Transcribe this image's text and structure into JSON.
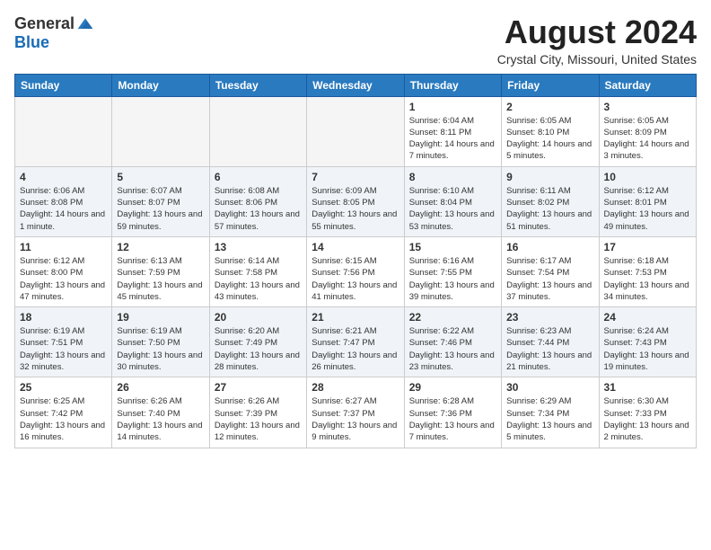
{
  "logo": {
    "general": "General",
    "blue": "Blue"
  },
  "title": "August 2024",
  "location": "Crystal City, Missouri, United States",
  "weekdays": [
    "Sunday",
    "Monday",
    "Tuesday",
    "Wednesday",
    "Thursday",
    "Friday",
    "Saturday"
  ],
  "weeks": [
    [
      {
        "day": "",
        "empty": true
      },
      {
        "day": "",
        "empty": true
      },
      {
        "day": "",
        "empty": true
      },
      {
        "day": "",
        "empty": true
      },
      {
        "day": "1",
        "sunrise": "6:04 AM",
        "sunset": "8:11 PM",
        "daylight": "14 hours and 7 minutes."
      },
      {
        "day": "2",
        "sunrise": "6:05 AM",
        "sunset": "8:10 PM",
        "daylight": "14 hours and 5 minutes."
      },
      {
        "day": "3",
        "sunrise": "6:05 AM",
        "sunset": "8:09 PM",
        "daylight": "14 hours and 3 minutes."
      }
    ],
    [
      {
        "day": "4",
        "sunrise": "6:06 AM",
        "sunset": "8:08 PM",
        "daylight": "14 hours and 1 minute."
      },
      {
        "day": "5",
        "sunrise": "6:07 AM",
        "sunset": "8:07 PM",
        "daylight": "13 hours and 59 minutes."
      },
      {
        "day": "6",
        "sunrise": "6:08 AM",
        "sunset": "8:06 PM",
        "daylight": "13 hours and 57 minutes."
      },
      {
        "day": "7",
        "sunrise": "6:09 AM",
        "sunset": "8:05 PM",
        "daylight": "13 hours and 55 minutes."
      },
      {
        "day": "8",
        "sunrise": "6:10 AM",
        "sunset": "8:04 PM",
        "daylight": "13 hours and 53 minutes."
      },
      {
        "day": "9",
        "sunrise": "6:11 AM",
        "sunset": "8:02 PM",
        "daylight": "13 hours and 51 minutes."
      },
      {
        "day": "10",
        "sunrise": "6:12 AM",
        "sunset": "8:01 PM",
        "daylight": "13 hours and 49 minutes."
      }
    ],
    [
      {
        "day": "11",
        "sunrise": "6:12 AM",
        "sunset": "8:00 PM",
        "daylight": "13 hours and 47 minutes."
      },
      {
        "day": "12",
        "sunrise": "6:13 AM",
        "sunset": "7:59 PM",
        "daylight": "13 hours and 45 minutes."
      },
      {
        "day": "13",
        "sunrise": "6:14 AM",
        "sunset": "7:58 PM",
        "daylight": "13 hours and 43 minutes."
      },
      {
        "day": "14",
        "sunrise": "6:15 AM",
        "sunset": "7:56 PM",
        "daylight": "13 hours and 41 minutes."
      },
      {
        "day": "15",
        "sunrise": "6:16 AM",
        "sunset": "7:55 PM",
        "daylight": "13 hours and 39 minutes."
      },
      {
        "day": "16",
        "sunrise": "6:17 AM",
        "sunset": "7:54 PM",
        "daylight": "13 hours and 37 minutes."
      },
      {
        "day": "17",
        "sunrise": "6:18 AM",
        "sunset": "7:53 PM",
        "daylight": "13 hours and 34 minutes."
      }
    ],
    [
      {
        "day": "18",
        "sunrise": "6:19 AM",
        "sunset": "7:51 PM",
        "daylight": "13 hours and 32 minutes."
      },
      {
        "day": "19",
        "sunrise": "6:19 AM",
        "sunset": "7:50 PM",
        "daylight": "13 hours and 30 minutes."
      },
      {
        "day": "20",
        "sunrise": "6:20 AM",
        "sunset": "7:49 PM",
        "daylight": "13 hours and 28 minutes."
      },
      {
        "day": "21",
        "sunrise": "6:21 AM",
        "sunset": "7:47 PM",
        "daylight": "13 hours and 26 minutes."
      },
      {
        "day": "22",
        "sunrise": "6:22 AM",
        "sunset": "7:46 PM",
        "daylight": "13 hours and 23 minutes."
      },
      {
        "day": "23",
        "sunrise": "6:23 AM",
        "sunset": "7:44 PM",
        "daylight": "13 hours and 21 minutes."
      },
      {
        "day": "24",
        "sunrise": "6:24 AM",
        "sunset": "7:43 PM",
        "daylight": "13 hours and 19 minutes."
      }
    ],
    [
      {
        "day": "25",
        "sunrise": "6:25 AM",
        "sunset": "7:42 PM",
        "daylight": "13 hours and 16 minutes."
      },
      {
        "day": "26",
        "sunrise": "6:26 AM",
        "sunset": "7:40 PM",
        "daylight": "13 hours and 14 minutes."
      },
      {
        "day": "27",
        "sunrise": "6:26 AM",
        "sunset": "7:39 PM",
        "daylight": "13 hours and 12 minutes."
      },
      {
        "day": "28",
        "sunrise": "6:27 AM",
        "sunset": "7:37 PM",
        "daylight": "13 hours and 9 minutes."
      },
      {
        "day": "29",
        "sunrise": "6:28 AM",
        "sunset": "7:36 PM",
        "daylight": "13 hours and 7 minutes."
      },
      {
        "day": "30",
        "sunrise": "6:29 AM",
        "sunset": "7:34 PM",
        "daylight": "13 hours and 5 minutes."
      },
      {
        "day": "31",
        "sunrise": "6:30 AM",
        "sunset": "7:33 PM",
        "daylight": "13 hours and 2 minutes."
      }
    ]
  ]
}
